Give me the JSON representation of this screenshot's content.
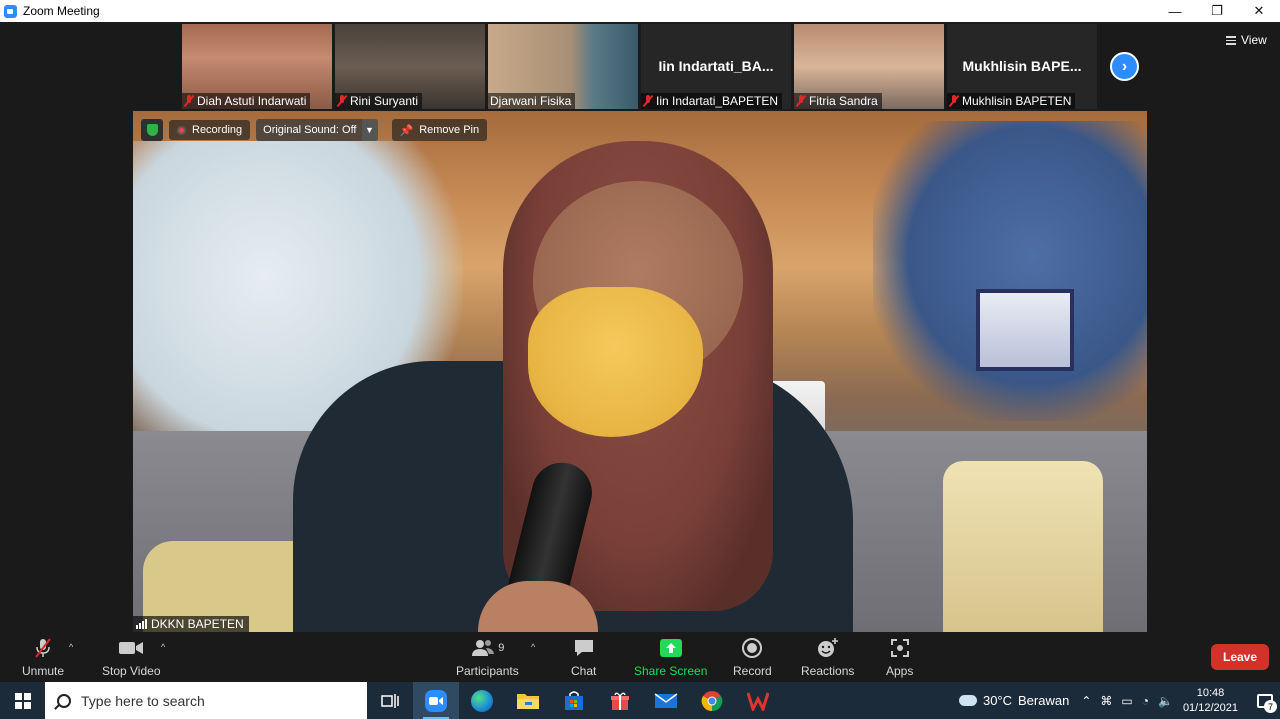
{
  "window": {
    "title": "Zoom Meeting",
    "controls": {
      "minimize": "—",
      "restore": "❐",
      "close": "✕"
    }
  },
  "gallery": {
    "participants": [
      {
        "name": "Diah Astuti Indarwati",
        "muted": true,
        "video": true
      },
      {
        "name": "Rini Suryanti",
        "muted": true,
        "video": true
      },
      {
        "name": "Djarwani Fisika",
        "muted": false,
        "video": true
      },
      {
        "name": "Iin Indartati_BAPETEN",
        "display_name": "Iin  Indartati_BA...",
        "muted": true,
        "video": false
      },
      {
        "name": "Fitria Sandra",
        "muted": true,
        "video": true
      },
      {
        "name": "Mukhlisin BAPETEN",
        "display_name": "Mukhlisin  BAPE...",
        "muted": true,
        "video": false
      }
    ],
    "view_label": "View"
  },
  "main_video": {
    "recording_label": "Recording",
    "original_sound_label": "Original Sound: Off",
    "remove_pin_label": "Remove Pin",
    "speaker_name": "DKKN BAPETEN"
  },
  "toolbar": {
    "unmute": "Unmute",
    "stop_video": "Stop Video",
    "participants": "Participants",
    "participants_count": "9",
    "chat": "Chat",
    "share_screen": "Share Screen",
    "record": "Record",
    "reactions": "Reactions",
    "apps": "Apps",
    "leave": "Leave",
    "share_color": "#23d959",
    "leave_color": "#d3322c"
  },
  "taskbar": {
    "search_placeholder": "Type here to search",
    "apps": [
      "task-view",
      "zoom",
      "edge",
      "file-explorer",
      "microsoft-store",
      "gift",
      "mail",
      "chrome",
      "wps"
    ],
    "weather_temp": "30°C",
    "weather_desc": "Berawan",
    "time": "10:48",
    "date": "01/12/2021",
    "notification_count": "7"
  }
}
